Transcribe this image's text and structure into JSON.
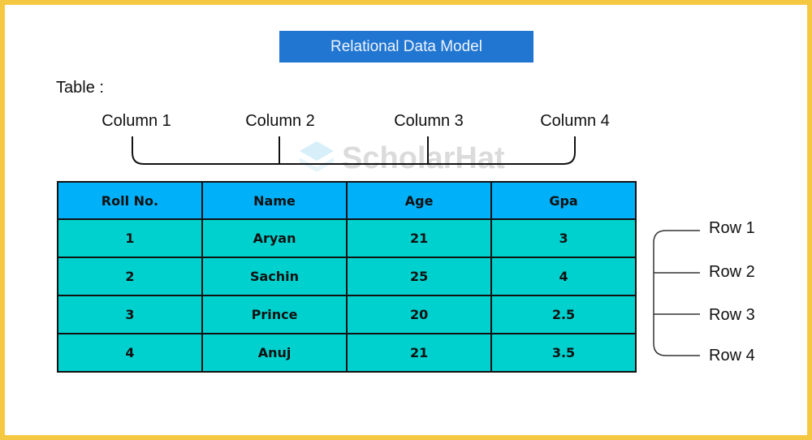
{
  "title": "Relational Data Model",
  "table_label": "Table :",
  "column_labels": [
    "Column 1",
    "Column 2",
    "Column 3",
    "Column 4"
  ],
  "row_labels": [
    "Row 1",
    "Row 2",
    "Row 3",
    "Row 4"
  ],
  "watermark": {
    "text": "ScholarHat",
    "icon": "stacked-layers-logo-icon"
  },
  "table": {
    "headers": [
      "Roll No.",
      "Name",
      "Age",
      "Gpa"
    ],
    "rows": [
      [
        "1",
        "Aryan",
        "21",
        "3"
      ],
      [
        "2",
        "Sachin",
        "25",
        "4"
      ],
      [
        "3",
        "Prince",
        "20",
        "2.5"
      ],
      [
        "4",
        "Anuj",
        "21",
        "3.5"
      ]
    ]
  },
  "colors": {
    "frame": "#f5c842",
    "title_background": "#2176d2",
    "header_background": "#00b0f8",
    "cell_background": "#00d1ce"
  }
}
